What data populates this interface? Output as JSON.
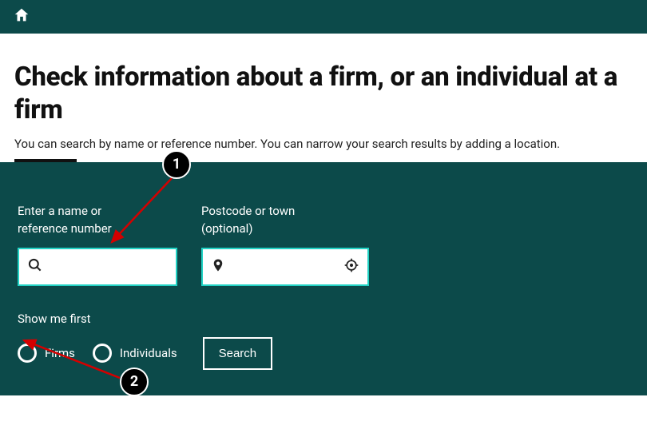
{
  "header": {
    "home_icon": "home-icon"
  },
  "page": {
    "title": "Check information about a firm, or an individual at a firm",
    "subtitle": "You can search by name or reference number. You can narrow your search results by adding a location."
  },
  "search": {
    "name_label_line1": "Enter a name or",
    "name_label_line2": "reference number",
    "name_value": "",
    "postcode_label_line1": "Postcode or town",
    "postcode_label_line2": "(optional)",
    "postcode_value": "",
    "show_label": "Show me first",
    "radio_options": [
      {
        "label": "Firms",
        "selected": false
      },
      {
        "label": "Individuals",
        "selected": false
      }
    ],
    "search_button": "Search"
  },
  "annotations": {
    "badge1": "1",
    "badge2": "2"
  }
}
